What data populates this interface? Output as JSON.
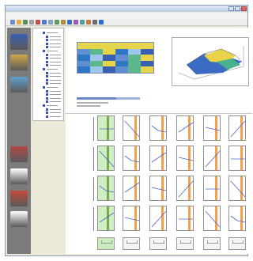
{
  "window": {
    "title": ""
  },
  "menu": [
    "",
    "",
    "",
    "",
    "",
    "",
    "",
    ""
  ],
  "toolbar_icons": [
    "new-icon",
    "open-icon",
    "save-icon",
    "print-icon",
    "cut-icon",
    "copy-icon",
    "paste-icon",
    "undo-icon",
    "redo-icon",
    "chart-icon",
    "grid-icon",
    "table-icon",
    "filter-icon",
    "zoom-icon",
    "help-icon"
  ],
  "leftbar": [
    {
      "name": "people-icon",
      "color": "#3b5fb6"
    },
    {
      "name": "network-icon",
      "color": "#d2a64a"
    },
    {
      "name": "flow-icon",
      "color": "#5fa0d0"
    },
    {
      "name": "bar-chart-icon",
      "color": "#b34747"
    },
    {
      "name": "table-icon",
      "color": "#ffffff"
    },
    {
      "name": "pie-chart-icon",
      "color": "#c84a3a"
    },
    {
      "name": "report-icon",
      "color": "#ffffff"
    }
  ],
  "colors": {
    "matrix_blue": "#2f76c4",
    "matrix_yellow": "#e6d44a",
    "matrix_green": "#5bb88a",
    "band_orange": "#f2a14a",
    "tile_green": "#cfeec3",
    "line_blue": "#4a63c8"
  },
  "grid": {
    "rows": 4,
    "cols": 6,
    "row_labels": [
      "",
      "",
      "",
      ""
    ],
    "tab_captions": [
      "",
      "",
      "",
      "",
      "",
      ""
    ]
  }
}
